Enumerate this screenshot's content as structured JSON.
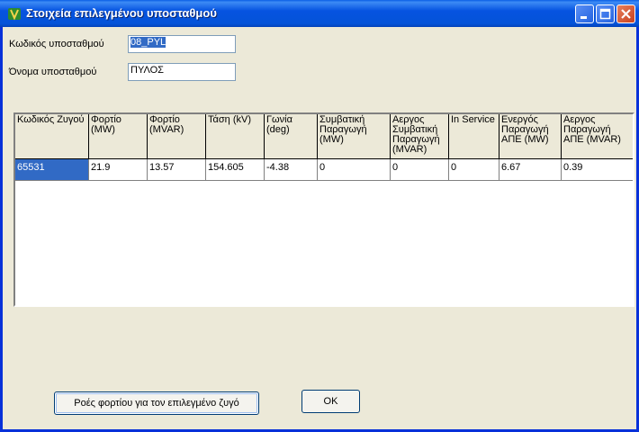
{
  "window": {
    "title": "Στοιχεία επιλεγμένου υποσταθμού"
  },
  "form": {
    "code_label": "Κωδικός υποσταθμού",
    "code_value": "08_PYL",
    "name_label": "Όνομα υποσταθμού",
    "name_value": "ΠΥΛΟΣ"
  },
  "table": {
    "headers": [
      "Κωδικός Ζυγού",
      "Φορτίο (MW)",
      "Φορτίο (MVAR)",
      "Τάση (kV)",
      "Γωνία (deg)",
      "Συμβατική Παραγωγή (MW)",
      "Αεργος Συμβατική Παραγωγή (MVAR)",
      "In Service",
      "Ενεργός Παραγωγή ΑΠΕ (MW)",
      "Αεργος Παραγωγή ΑΠΕ (MVAR)"
    ],
    "rows": [
      [
        "65531",
        "21.9",
        "13.57",
        "154.605",
        "-4.38",
        "0",
        "0",
        "0",
        "6.67",
        "0.39"
      ]
    ]
  },
  "buttons": {
    "flows": "Ροές φορτίου για τον επιλεγμένο ζυγό",
    "ok": "OK"
  },
  "colors": {
    "titlebar": "#0453d8",
    "selection": "#316ac5",
    "background": "#ece9d8"
  }
}
